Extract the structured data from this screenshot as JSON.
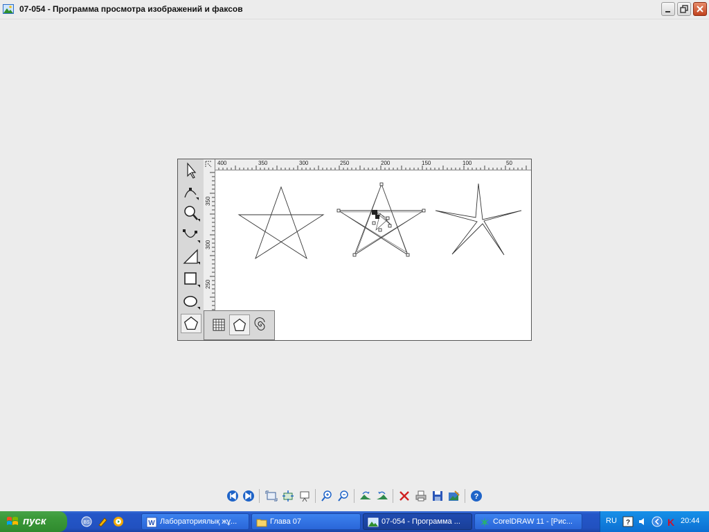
{
  "window": {
    "title": "07-054 - Программа просмотра изображений и факсов",
    "icon": "image-viewer-icon",
    "buttons": [
      "minimize-icon",
      "restore-icon",
      "close-icon"
    ]
  },
  "image": {
    "ruler_top_labels": [
      "400",
      "350",
      "300",
      "250",
      "200",
      "150",
      "100",
      "50"
    ],
    "ruler_left_labels": [
      "350",
      "300",
      "250"
    ],
    "tools": [
      "pick-tool-icon",
      "shape-tool-icon",
      "zoom-tool-icon",
      "curve-tool-icon",
      "dimension-tool-icon",
      "rectangle-tool-icon",
      "ellipse-tool-icon",
      "polygon-tool-icon"
    ],
    "flyout": [
      "graph-paper-icon",
      "polygon-icon",
      "spiral-icon"
    ]
  },
  "viewer_toolbar": {
    "buttons": [
      "previous-image-icon",
      "next-image-icon",
      "best-fit-icon",
      "actual-size-icon",
      "slideshow-icon",
      "zoom-in-icon",
      "zoom-out-icon",
      "rotate-clockwise-icon",
      "rotate-counterclockwise-icon",
      "delete-icon",
      "print-icon",
      "save-icon",
      "edit-icon",
      "help-icon"
    ]
  },
  "taskbar": {
    "start_label": "пуск",
    "tasks": [
      {
        "label": "Лабораториялық жұ...",
        "icon": "word-icon"
      },
      {
        "label": "Глава 07",
        "icon": "folder-icon"
      },
      {
        "label": "07-054 - Программа ...",
        "icon": "image-viewer-icon"
      },
      {
        "label": "CorelDRAW 11 - [Рис...",
        "icon": "coreldraw-icon"
      }
    ],
    "tray": {
      "lang": "RU",
      "clock": "20:44"
    }
  },
  "colors": {
    "taskbar": "#2457c8",
    "start": "#3c9a3a",
    "close": "#c0421e"
  }
}
